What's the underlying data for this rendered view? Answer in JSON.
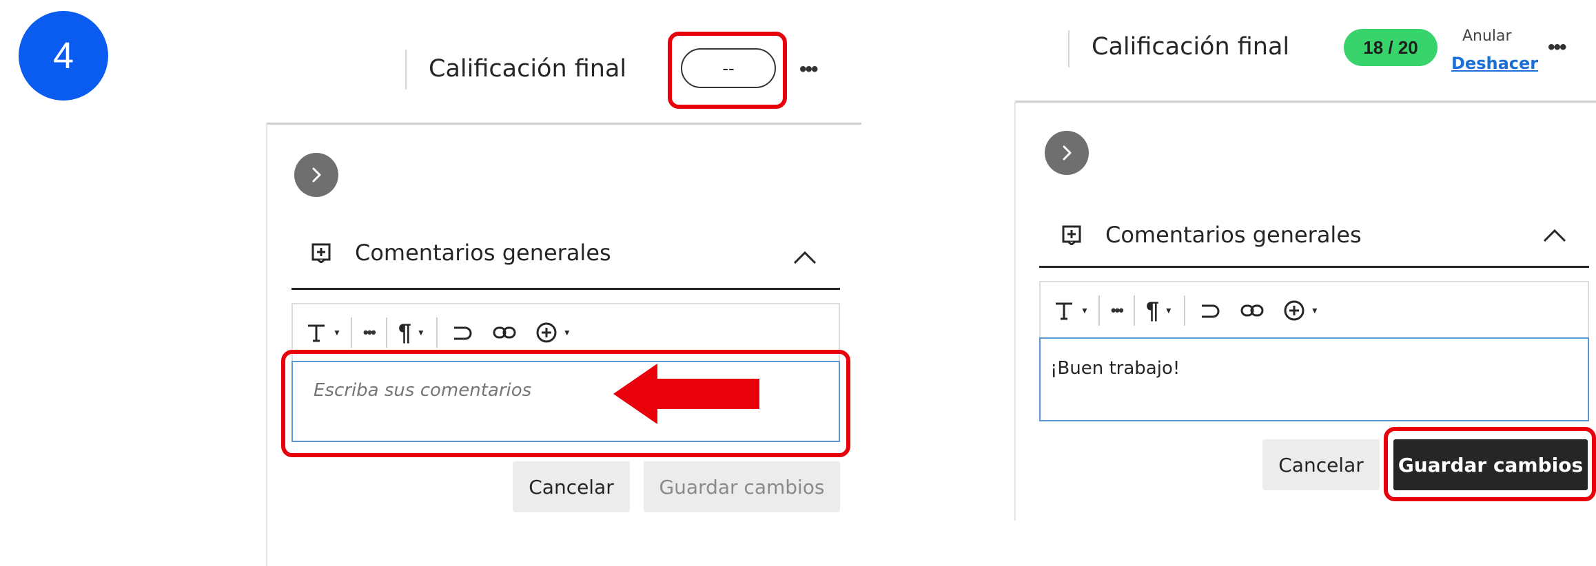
{
  "step": "4",
  "left_panel": {
    "header_title": "Calificación final",
    "grade_value": "--",
    "more_label": "•••",
    "section_title": "Comentarios generales",
    "editor_placeholder": "Escriba sus comentarios",
    "cancel_label": "Cancelar",
    "save_label": "Guardar cambios"
  },
  "right_panel": {
    "header_title": "Calificación final",
    "grade_value": "18 / 20",
    "override_label": "Anular",
    "undo_label": "Deshacer",
    "more_label": "•••",
    "section_title": "Comentarios generales",
    "editor_value": "¡Buen trabajo!",
    "cancel_label": "Cancelar",
    "save_label": "Guardar cambios"
  },
  "toolbar": {
    "more_label": "•••"
  },
  "colors": {
    "step_badge": "#0a5cf0",
    "highlight": "#e8000b",
    "grade_badge": "#38d36a",
    "editor_border": "#5a97d6",
    "primary_button": "#262626",
    "link": "#1a6ed8"
  },
  "icons": {
    "expand": "chevron-right-icon",
    "section": "add-comment-icon",
    "collapse": "chevron-up-icon",
    "text_format": "text-format-icon",
    "paragraph": "paragraph-icon",
    "undo": "undo-icon",
    "link": "link-icon",
    "insert": "insert-plus-icon",
    "arrow": "arrow-left-icon"
  }
}
